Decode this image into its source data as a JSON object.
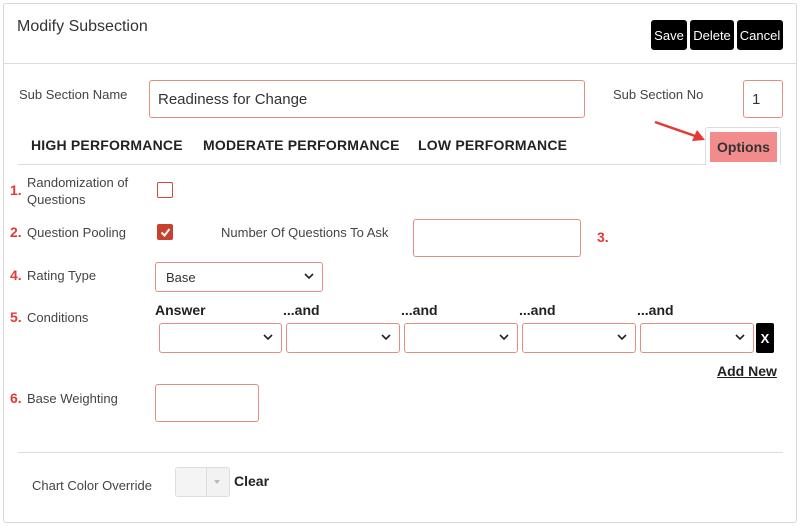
{
  "dialog": {
    "title": "Modify Subsection",
    "buttons": {
      "save": "Save",
      "delete": "Delete",
      "cancel": "Cancel"
    }
  },
  "sub_section": {
    "name_label": "Sub Section Name",
    "name_value": "Readiness for Change",
    "no_label": "Sub Section No",
    "no_value": "1"
  },
  "tabs": [
    "HIGH PERFORMANCE",
    "MODERATE PERFORMANCE",
    "LOW PERFORMANCE",
    "Options"
  ],
  "options": {
    "randomization": {
      "number": "1.",
      "label_line1": "Randomization of",
      "label_line2": "Questions",
      "checked": false
    },
    "pooling": {
      "number": "2.",
      "label": "Question Pooling",
      "checked": true
    },
    "num_questions": {
      "number": "3.",
      "label": "Number Of Questions To Ask",
      "value": ""
    },
    "rating": {
      "number": "4.",
      "label": "Rating Type",
      "selected": "Base"
    },
    "conditions": {
      "number": "5.",
      "label": "Conditions",
      "headers": [
        "Answer",
        "...and",
        "...and",
        "...and",
        "...and"
      ],
      "remove_label": "X",
      "add_new": "Add New"
    },
    "weighting": {
      "number": "6.",
      "label": "Base Weighting",
      "value": ""
    }
  },
  "chart_color": {
    "label": "Chart Color Override",
    "clear": "Clear"
  },
  "colors": {
    "accent": "#c8412f",
    "options_tab_bg": "#f28b8b",
    "annotation_red": "#e53935"
  }
}
